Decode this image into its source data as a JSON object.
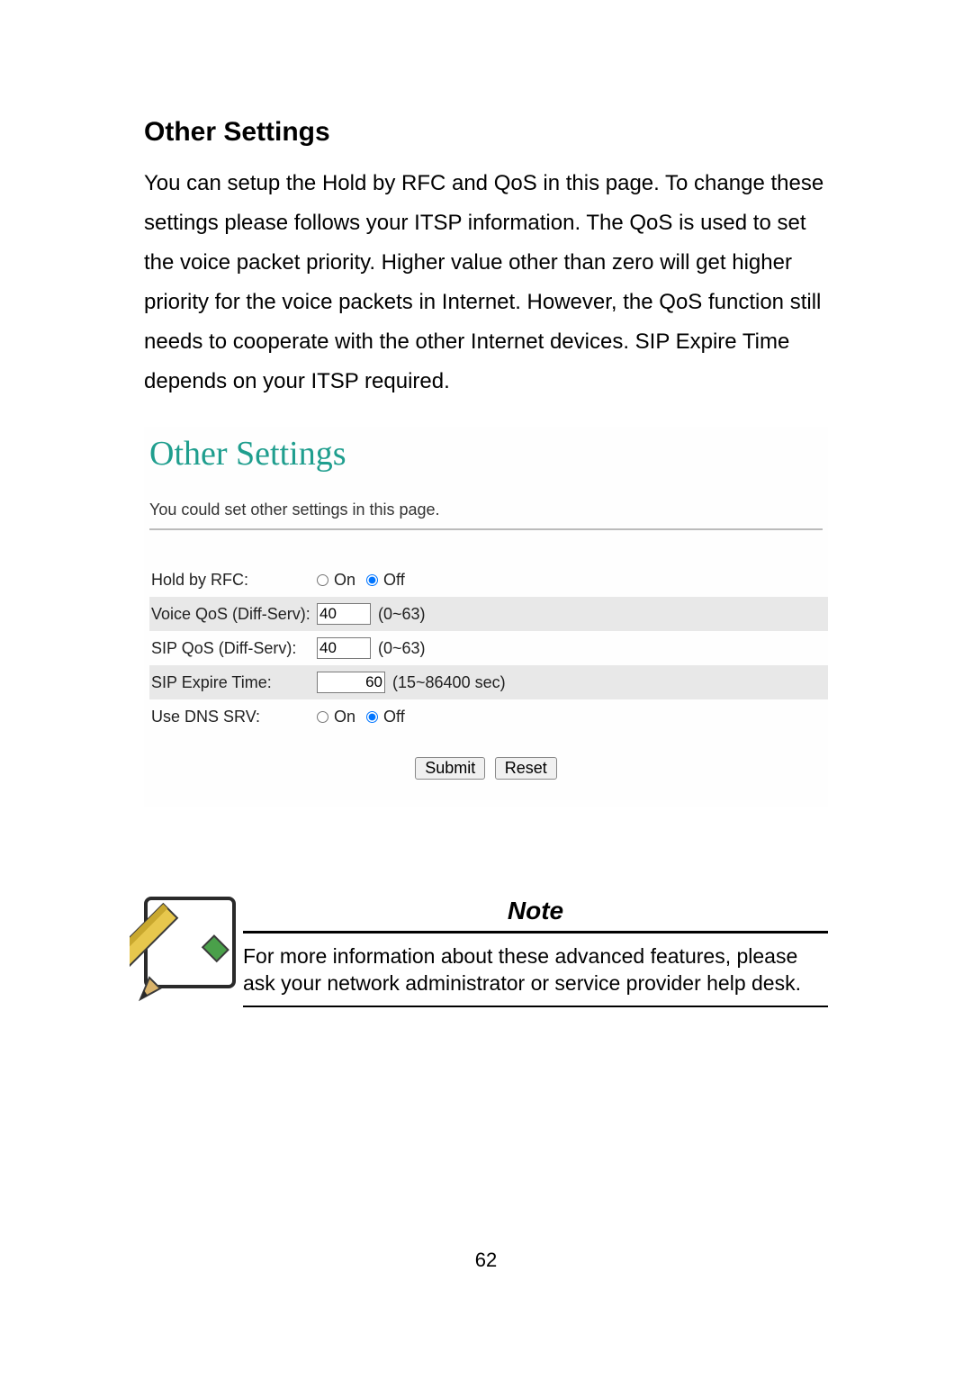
{
  "section_title": "Other Settings",
  "body_text": "You can setup the Hold by RFC and QoS in this page. To change these settings please follows your ITSP information. The QoS is used to set the voice packet priority.    Higher value other than zero will get higher priority for the voice packets in Internet.    However, the QoS function still needs to cooperate with the other Internet devices. SIP Expire Time depends on your ITSP required.",
  "screenshot": {
    "title": "Other Settings",
    "subtitle": "You could set other settings in this page.",
    "rows": {
      "hold_by_rfc": {
        "label": "Hold by RFC:",
        "on": "On",
        "off": "Off",
        "selected": "off"
      },
      "voice_qos": {
        "label": "Voice QoS (Diff-Serv):",
        "value": "40",
        "hint": "(0~63)"
      },
      "sip_qos": {
        "label": "SIP QoS (Diff-Serv):",
        "value": "40",
        "hint": "(0~63)"
      },
      "sip_expire": {
        "label": "SIP Expire Time:",
        "value": "60",
        "hint": "(15~86400 sec)"
      },
      "use_dns_srv": {
        "label": "Use DNS SRV:",
        "on": "On",
        "off": "Off",
        "selected": "off"
      }
    },
    "buttons": {
      "submit": "Submit",
      "reset": "Reset"
    }
  },
  "note": {
    "title": "Note",
    "text": "For more information about these advanced features, please ask your network administrator or service provider help desk."
  },
  "page_number": "62"
}
